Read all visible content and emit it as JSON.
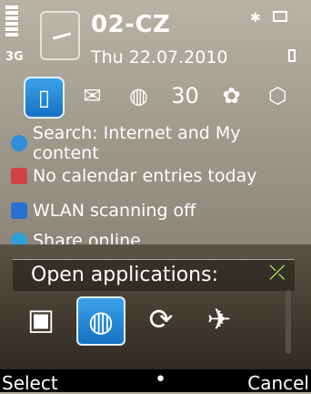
{
  "status": {
    "network": "3G",
    "operator": "02-CZ",
    "date": "Thu 22.07.2010",
    "bluetooth_icon": "bluetooth-icon",
    "message_icon": "message-icon"
  },
  "shortcuts": [
    "contacts",
    "messages",
    "web",
    "calendar",
    "photos",
    "maps"
  ],
  "list": [
    {
      "label": "Search: Internet and My content",
      "icon": "search-icon"
    },
    {
      "label": "No calendar entries today",
      "icon": "calendar-icon"
    },
    {
      "label": "WLAN scanning off",
      "icon": "wlan-icon"
    },
    {
      "label": "Share online",
      "icon": "share-icon"
    }
  ],
  "popup": {
    "title": "Open applications:",
    "apps": [
      "gallery",
      "web",
      "sync",
      "share"
    ]
  },
  "softkeys": {
    "left": "Select",
    "middle": "•",
    "right": "Cancel"
  }
}
